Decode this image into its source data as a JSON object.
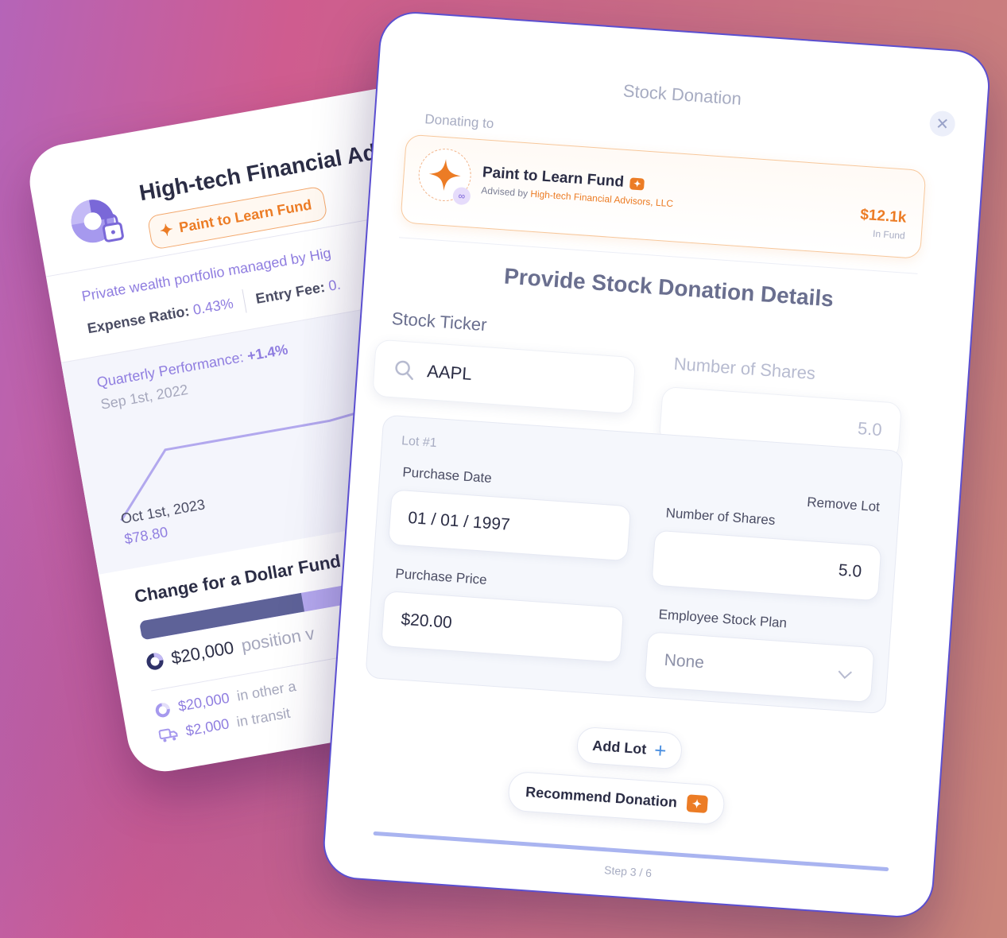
{
  "back_card": {
    "title": "High-tech Financial Ad",
    "fund_badge": "Paint to Learn Fund",
    "description": "Private wealth portfolio managed by Hig",
    "expense_ratio_label": "Expense Ratio:",
    "expense_ratio_value": "0.43%",
    "entry_fee_label": "Entry Fee:",
    "entry_fee_value": "0.",
    "quarterly_label": "Quarterly Performance:",
    "quarterly_value": "+1.4%",
    "date_start": "Sep 1st, 2022",
    "date_point": "Oct 1st, 2023",
    "price_point": "$78.80",
    "change_title": "Change for a Dollar Fund",
    "bar_fill_fraction": 0.45,
    "position_amount": "$20,000",
    "position_suffix": "position v",
    "other_amount": "$20,000",
    "other_suffix": "in other a",
    "transit_amount": "$2,000",
    "transit_suffix": "in transit"
  },
  "modal": {
    "title": "Stock Donation",
    "close_icon": "close-icon",
    "donating_to_label": "Donating to",
    "fund": {
      "name": "Paint to Learn Fund",
      "advised_by_prefix": "Advised by",
      "advisor": "High-tech Financial Advisors, LLC",
      "amount": "$12.1k",
      "amount_label": "In Fund",
      "logo_icon": "sparkle-icon"
    },
    "heading": "Provide Stock Donation Details",
    "stock_ticker_label": "Stock Ticker",
    "stock_ticker_value": "AAPL",
    "number_of_shares_label": "Number of Shares",
    "number_of_shares_value": "5.0",
    "lot": {
      "title": "Lot #1",
      "purchase_date_label": "Purchase Date",
      "purchase_date_value": "01 / 01 / 1997",
      "remove_label": "Remove Lot",
      "shares_label": "Number of Shares",
      "shares_value": "5.0",
      "purchase_price_label": "Purchase Price",
      "purchase_price_value": "$20.00",
      "employee_plan_label": "Employee Stock Plan",
      "employee_plan_value": "None"
    },
    "add_lot_label": "Add Lot",
    "recommend_label": "Recommend Donation",
    "step_text": "Step 3 / 6",
    "progress_fraction": 1.0
  },
  "colors": {
    "accent_orange": "#ec7c25",
    "accent_purple": "#8f7de0",
    "modal_border": "#5b4fd0",
    "progress": "#a9b4f0"
  }
}
